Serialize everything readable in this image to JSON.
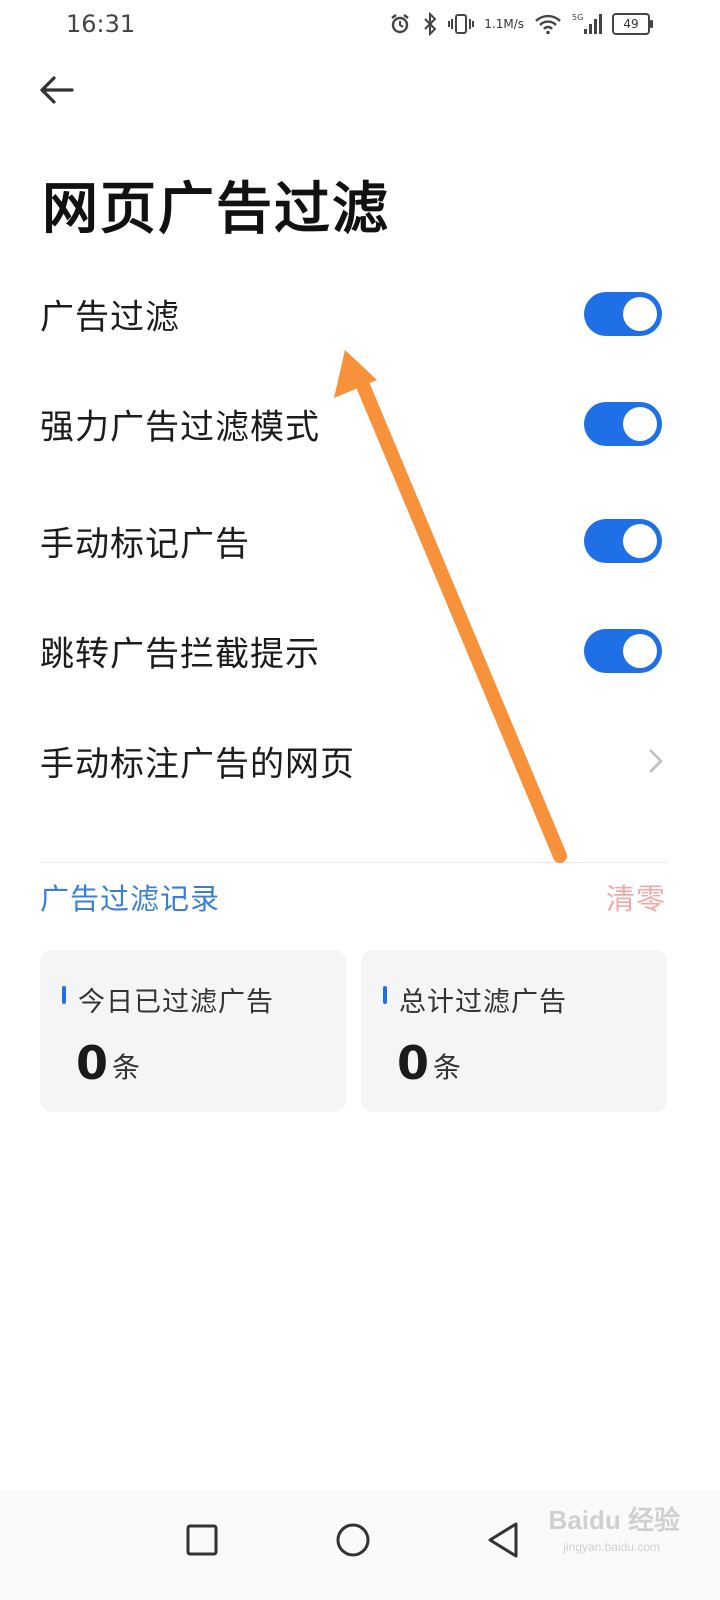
{
  "status_bar": {
    "time": "16:31",
    "net_speed_value": "1.1",
    "net_speed_unit": "M/s",
    "network_type": "5G",
    "battery": "49",
    "icons": [
      "alarm-icon",
      "bluetooth-icon",
      "vibrate-icon",
      "wifi-icon",
      "signal-icon",
      "battery-icon"
    ]
  },
  "header": {
    "title": "网页广告过滤"
  },
  "settings": [
    {
      "label": "广告过滤",
      "type": "toggle",
      "on": true
    },
    {
      "label": "强力广告过滤模式",
      "type": "toggle",
      "on": true
    },
    {
      "label": "手动标记广告",
      "type": "toggle",
      "on": true
    },
    {
      "label": "跳转广告拦截提示",
      "type": "toggle",
      "on": true
    },
    {
      "label": "手动标注广告的网页",
      "type": "link"
    }
  ],
  "records": {
    "section_title": "广告过滤记录",
    "clear_label": "清零",
    "cards": [
      {
        "label": "今日已过滤广告",
        "value": "0",
        "unit": "条"
      },
      {
        "label": "总计过滤广告",
        "value": "0",
        "unit": "条"
      }
    ]
  },
  "colors": {
    "accent": "#1f6fe6",
    "section_title": "#3a7fd3",
    "clear": "#f3a8a8",
    "annotation_arrow": "#f7913a"
  },
  "watermark": {
    "brand": "Baidu 经验",
    "sub": "jingyan.baidu.com"
  }
}
